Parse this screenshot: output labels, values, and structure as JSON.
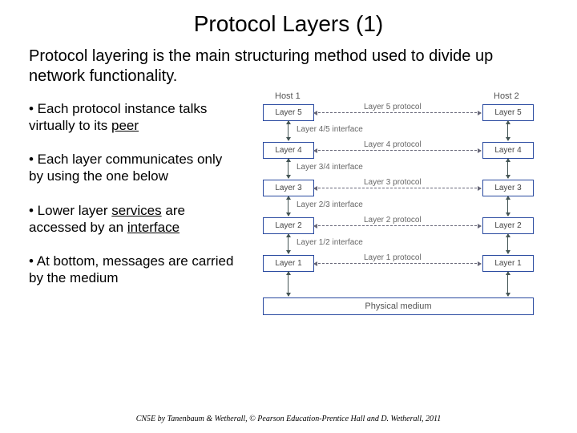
{
  "title": "Protocol Layers (1)",
  "intro": "Protocol layering is the main structuring method used to divide up network functionality.",
  "bullets": [
    {
      "pre": "• Each protocol instance talks virtually to its ",
      "u": "peer",
      "post": ""
    },
    {
      "pre": "• Each layer communicates only by using the one below",
      "u": "",
      "post": ""
    },
    {
      "pre": "• Lower layer ",
      "u": "services",
      "post": " are accessed by an ",
      "u2": "interface"
    },
    {
      "pre": "• At bottom, messages are carried by the medium",
      "u": "",
      "post": ""
    }
  ],
  "diagram": {
    "host1": "Host 1",
    "host2": "Host 2",
    "layers": [
      "Layer 5",
      "Layer 4",
      "Layer 3",
      "Layer 2",
      "Layer 1"
    ],
    "protocols": [
      "Layer 5 protocol",
      "Layer 4 protocol",
      "Layer 3 protocol",
      "Layer 2 protocol",
      "Layer 1 protocol"
    ],
    "interfaces": [
      "Layer 4/5 interface",
      "Layer 3/4 interface",
      "Layer 2/3 interface",
      "Layer 1/2 interface"
    ],
    "medium": "Physical medium"
  },
  "footer": "CN5E by Tanenbaum & Wetherall, © Pearson Education-Prentice Hall and D. Wetherall, 2011"
}
